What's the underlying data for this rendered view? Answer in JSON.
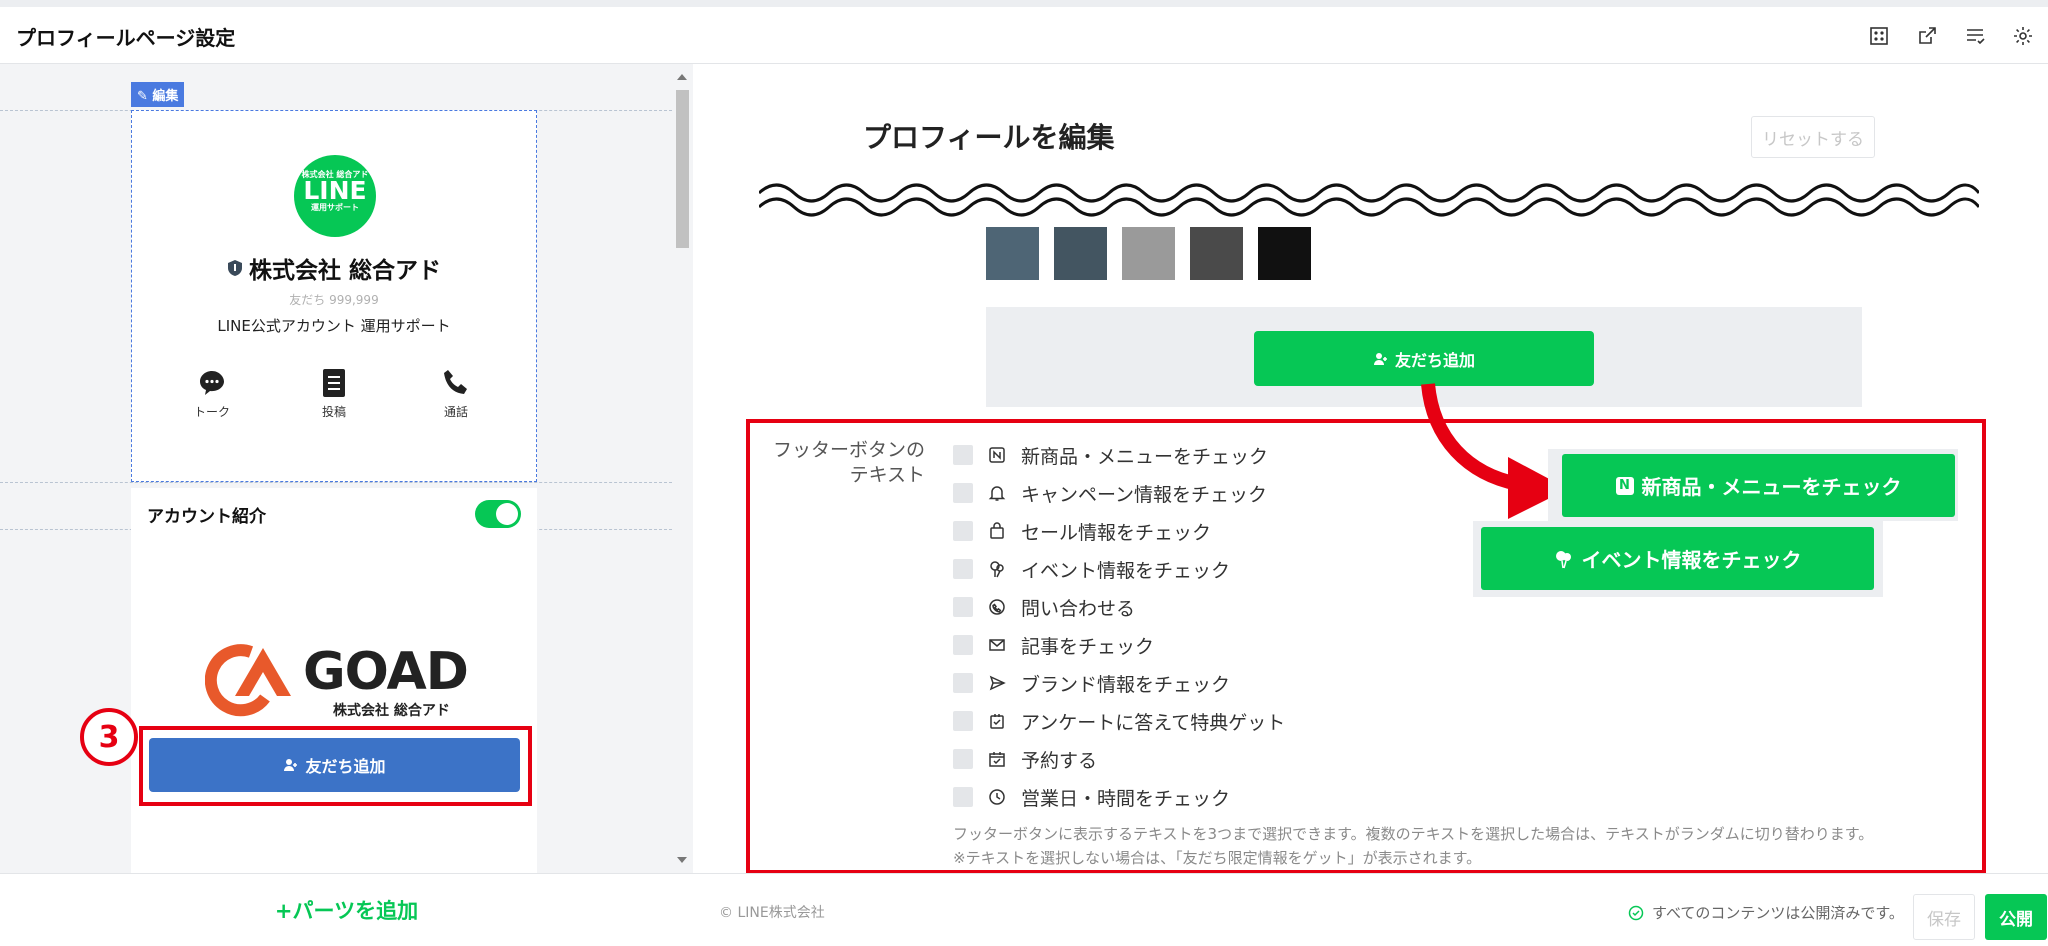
{
  "header": {
    "title": "プロフィールページ設定",
    "icons": [
      "grid-icon",
      "external-link-icon",
      "list-check-icon",
      "gear-icon"
    ]
  },
  "left": {
    "edit_tag": "✎ 編集",
    "logo": {
      "line1": "株式会社 総合アド",
      "line2": "LINE",
      "line3": "運用サポート"
    },
    "account_name": "株式会社 総合アド",
    "friends": "友だち 999,999",
    "description": "LINE公式アカウント 運用サポート",
    "actions": [
      {
        "label": "トーク",
        "icon": "chat-icon"
      },
      {
        "label": "投稿",
        "icon": "document-icon"
      },
      {
        "label": "通話",
        "icon": "phone-icon"
      }
    ],
    "account_intro_label": "アカウント紹介",
    "goad_word": "GOAD",
    "goad_company": "株式会社 総合アド",
    "badge": "3",
    "add_friend_button": "友だち追加",
    "add_parts": "+パーツを追加"
  },
  "right": {
    "title": "プロフィールを編集",
    "reset": "リセットする",
    "swatches": [
      "#4e6575",
      "#435561",
      "#9a9a9a",
      "#4a4a4a",
      "#111111"
    ],
    "add_friend_button": "友だち追加",
    "footer_label_1": "フッターボタンの",
    "footer_label_2": "テキスト",
    "options": [
      "新商品・メニューをチェック",
      "キャンペーン情報をチェック",
      "セール情報をチェック",
      "イベント情報をチェック",
      "問い合わせる",
      "記事をチェック",
      "ブランド情報をチェック",
      "アンケートに答えて特典ゲット",
      "予約する",
      "営業日・時間をチェック"
    ],
    "note_1": "フッターボタンに表示するテキストを3つまで選択できます。複数のテキストを選択した場合は、テキストがランダムに切り替わります。",
    "note_2": "※テキストを選択しない場合は、「友だち限定情報をゲット」が表示されます。",
    "preview_1": "新商品・メニューをチェック",
    "preview_2": "イベント情報をチェック"
  },
  "bottom": {
    "copyright": "© LINE株式会社",
    "status": "すべてのコンテンツは公開済みです。",
    "save": "保存",
    "publish": "公開"
  },
  "colors": {
    "accent_green": "#06c755",
    "highlight_red": "#e60012",
    "button_blue": "#3c73c7"
  }
}
